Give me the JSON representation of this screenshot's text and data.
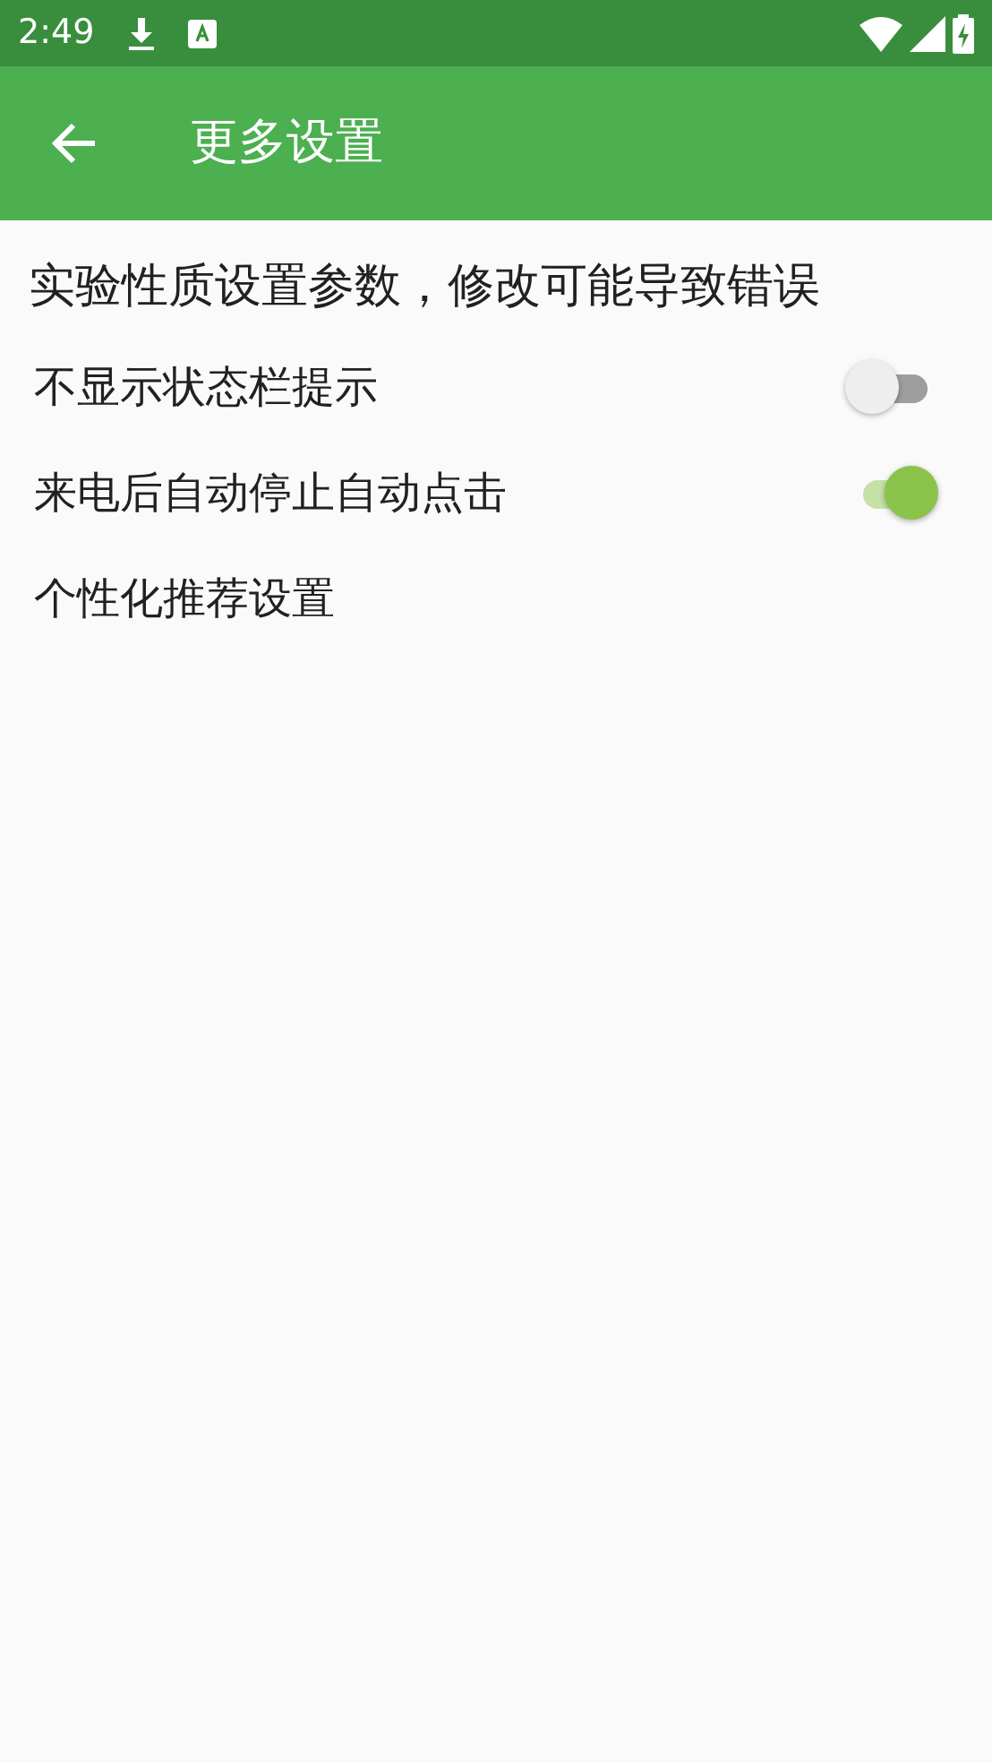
{
  "status_bar": {
    "time": "2:49"
  },
  "app_bar": {
    "title": "更多设置"
  },
  "notice": "实验性质设置参数，修改可能导致错误",
  "settings": [
    {
      "label": "不显示状态栏提示",
      "kind": "switch",
      "on": false
    },
    {
      "label": "来电后自动停止自动点击",
      "kind": "switch",
      "on": true
    },
    {
      "label": "个性化推荐设置",
      "kind": "link"
    }
  ]
}
